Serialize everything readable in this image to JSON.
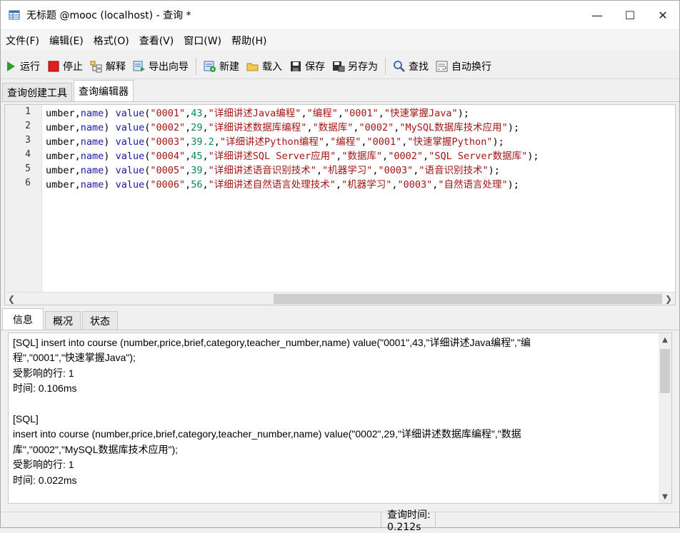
{
  "window": {
    "title": "无标题 @mooc (localhost) - 查询 *",
    "controls": {
      "minimize": "—",
      "maximize": "☐",
      "close": "✕"
    }
  },
  "menu": [
    "文件(F)",
    "编辑(E)",
    "格式(O)",
    "查看(V)",
    "窗口(W)",
    "帮助(H)"
  ],
  "toolbar": {
    "run": "运行",
    "stop": "停止",
    "explain": "解释",
    "export_wizard": "导出向导",
    "new": "新建",
    "load": "载入",
    "save": "保存",
    "save_as": "另存为",
    "find": "查找",
    "word_wrap": "自动换行"
  },
  "top_tabs": [
    "查询创建工具",
    "查询编辑器"
  ],
  "editor": {
    "line_numbers": [
      "1",
      "2",
      "3",
      "4",
      "5",
      "6"
    ],
    "lines": [
      [
        {
          "t": "umber,",
          "c": "plain"
        },
        {
          "t": "name",
          "c": "kw"
        },
        {
          "t": ") ",
          "c": "plain"
        },
        {
          "t": "value",
          "c": "kw"
        },
        {
          "t": "(",
          "c": "plain"
        },
        {
          "t": "\"0001\"",
          "c": "str"
        },
        {
          "t": ",",
          "c": "plain"
        },
        {
          "t": "43",
          "c": "num"
        },
        {
          "t": ",",
          "c": "plain"
        },
        {
          "t": "\"详细讲述Java编程\"",
          "c": "str"
        },
        {
          "t": ",",
          "c": "plain"
        },
        {
          "t": "\"编程\"",
          "c": "str"
        },
        {
          "t": ",",
          "c": "plain"
        },
        {
          "t": "\"0001\"",
          "c": "str"
        },
        {
          "t": ",",
          "c": "plain"
        },
        {
          "t": "\"快速掌握Java\"",
          "c": "str"
        },
        {
          "t": ");",
          "c": "plain"
        }
      ],
      [
        {
          "t": "umber,",
          "c": "plain"
        },
        {
          "t": "name",
          "c": "kw"
        },
        {
          "t": ") ",
          "c": "plain"
        },
        {
          "t": "value",
          "c": "kw"
        },
        {
          "t": "(",
          "c": "plain"
        },
        {
          "t": "\"0002\"",
          "c": "str"
        },
        {
          "t": ",",
          "c": "plain"
        },
        {
          "t": "29",
          "c": "num"
        },
        {
          "t": ",",
          "c": "plain"
        },
        {
          "t": "\"详细讲述数据库编程\"",
          "c": "str"
        },
        {
          "t": ",",
          "c": "plain"
        },
        {
          "t": "\"数据库\"",
          "c": "str"
        },
        {
          "t": ",",
          "c": "plain"
        },
        {
          "t": "\"0002\"",
          "c": "str"
        },
        {
          "t": ",",
          "c": "plain"
        },
        {
          "t": "\"MySQL数据库技术应用\"",
          "c": "str"
        },
        {
          "t": ");",
          "c": "plain"
        }
      ],
      [
        {
          "t": "umber,",
          "c": "plain"
        },
        {
          "t": "name",
          "c": "kw"
        },
        {
          "t": ") ",
          "c": "plain"
        },
        {
          "t": "value",
          "c": "kw"
        },
        {
          "t": "(",
          "c": "plain"
        },
        {
          "t": "\"0003\"",
          "c": "str"
        },
        {
          "t": ",",
          "c": "plain"
        },
        {
          "t": "39.2",
          "c": "num"
        },
        {
          "t": ",",
          "c": "plain"
        },
        {
          "t": "\"详细讲述Python编程\"",
          "c": "str"
        },
        {
          "t": ",",
          "c": "plain"
        },
        {
          "t": "\"编程\"",
          "c": "str"
        },
        {
          "t": ",",
          "c": "plain"
        },
        {
          "t": "\"0001\"",
          "c": "str"
        },
        {
          "t": ",",
          "c": "plain"
        },
        {
          "t": "\"快速掌握Python\"",
          "c": "str"
        },
        {
          "t": ");",
          "c": "plain"
        }
      ],
      [
        {
          "t": "umber,",
          "c": "plain"
        },
        {
          "t": "name",
          "c": "kw"
        },
        {
          "t": ") ",
          "c": "plain"
        },
        {
          "t": "value",
          "c": "kw"
        },
        {
          "t": "(",
          "c": "plain"
        },
        {
          "t": "\"0004\"",
          "c": "str"
        },
        {
          "t": ",",
          "c": "plain"
        },
        {
          "t": "45",
          "c": "num"
        },
        {
          "t": ",",
          "c": "plain"
        },
        {
          "t": "\"详细讲述SQL Server应用\"",
          "c": "str"
        },
        {
          "t": ",",
          "c": "plain"
        },
        {
          "t": "\"数据库\"",
          "c": "str"
        },
        {
          "t": ",",
          "c": "plain"
        },
        {
          "t": "\"0002\"",
          "c": "str"
        },
        {
          "t": ",",
          "c": "plain"
        },
        {
          "t": "\"SQL Server数据库\"",
          "c": "str"
        },
        {
          "t": ");",
          "c": "plain"
        }
      ],
      [
        {
          "t": "umber,",
          "c": "plain"
        },
        {
          "t": "name",
          "c": "kw"
        },
        {
          "t": ") ",
          "c": "plain"
        },
        {
          "t": "value",
          "c": "kw"
        },
        {
          "t": "(",
          "c": "plain"
        },
        {
          "t": "\"0005\"",
          "c": "str"
        },
        {
          "t": ",",
          "c": "plain"
        },
        {
          "t": "39",
          "c": "num"
        },
        {
          "t": ",",
          "c": "plain"
        },
        {
          "t": "\"详细讲述语音识别技术\"",
          "c": "str"
        },
        {
          "t": ",",
          "c": "plain"
        },
        {
          "t": "\"机器学习\"",
          "c": "str"
        },
        {
          "t": ",",
          "c": "plain"
        },
        {
          "t": "\"0003\"",
          "c": "str"
        },
        {
          "t": ",",
          "c": "plain"
        },
        {
          "t": "\"语音识别技术\"",
          "c": "str"
        },
        {
          "t": ");",
          "c": "plain"
        }
      ],
      [
        {
          "t": "umber,",
          "c": "plain"
        },
        {
          "t": "name",
          "c": "kw"
        },
        {
          "t": ") ",
          "c": "plain"
        },
        {
          "t": "value",
          "c": "kw"
        },
        {
          "t": "(",
          "c": "plain"
        },
        {
          "t": "\"0006\"",
          "c": "str"
        },
        {
          "t": ",",
          "c": "plain"
        },
        {
          "t": "56",
          "c": "num"
        },
        {
          "t": ",",
          "c": "plain"
        },
        {
          "t": "\"详细讲述自然语言处理技术\"",
          "c": "str"
        },
        {
          "t": ",",
          "c": "plain"
        },
        {
          "t": "\"机器学习\"",
          "c": "str"
        },
        {
          "t": ",",
          "c": "plain"
        },
        {
          "t": "\"0003\"",
          "c": "str"
        },
        {
          "t": ",",
          "c": "plain"
        },
        {
          "t": "\"自然语言处理\"",
          "c": "str"
        },
        {
          "t": ");",
          "c": "plain"
        }
      ]
    ]
  },
  "bottom_tabs": [
    "信息",
    "概况",
    "状态"
  ],
  "messages": [
    "[SQL] insert into course (number,price,brief,category,teacher_number,name) value(\"0001\",43,\"详细讲述Java编程\",\"编",
    "程\",\"0001\",\"快速掌握Java\");",
    "受影响的行: 1",
    "时间: 0.106ms",
    "",
    "[SQL]",
    "insert into course (number,price,brief,category,teacher_number,name) value(\"0002\",29,\"详细讲述数据库编程\",\"数据",
    "库\",\"0002\",\"MySQL数据库技术应用\");",
    "受影响的行: 1",
    "时间: 0.022ms"
  ],
  "status": {
    "query_time": "查询时间: 0.212s"
  },
  "colors": {
    "keyword": "#1a1aa6",
    "string": "#a31515",
    "number": "#098658",
    "stop_red": "#e02020",
    "run_green": "#2aa02a"
  }
}
